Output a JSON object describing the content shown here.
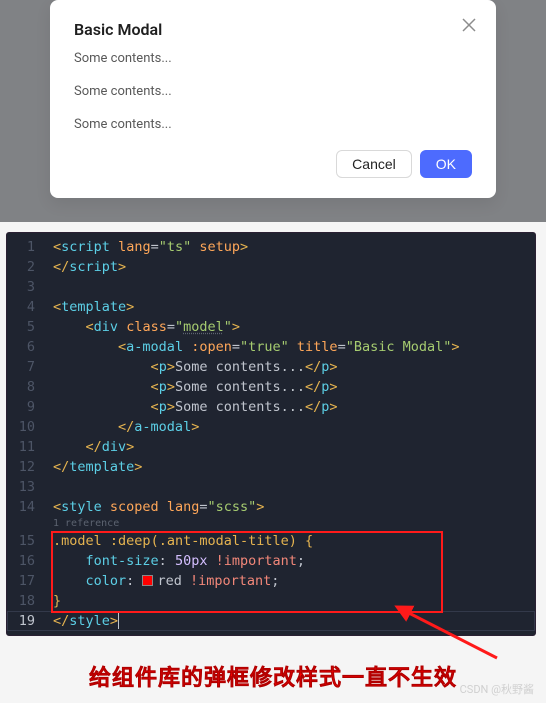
{
  "modal": {
    "title": "Basic Modal",
    "contents": [
      "Some contents...",
      "Some contents...",
      "Some contents..."
    ],
    "cancel_label": "Cancel",
    "ok_label": "OK"
  },
  "editor": {
    "reference_text": "1 reference",
    "lines": {
      "l1": "<script lang=\"ts\" setup>",
      "l2": "</script>",
      "l4": "<template>",
      "l5": "    <div class=\"model\">",
      "l6": "        <a-modal :open=\"true\" title=\"Basic Modal\">",
      "l7": "            <p>Some contents...</p>",
      "l8": "            <p>Some contents...</p>",
      "l9": "            <p>Some contents...</p>",
      "l10": "        </a-modal>",
      "l11": "    </div>",
      "l12": "</template>",
      "l14": "<style scoped lang=\"scss\">",
      "l15": ".model :deep(.ant-modal-title) {",
      "l16": "    font-size: 50px !important;",
      "l17": "    color: red !important;",
      "l18": "}",
      "l19": "</style>"
    }
  },
  "caption": "给组件库的弹框修改样式一直不生效",
  "watermark": "CSDN @秋野酱"
}
